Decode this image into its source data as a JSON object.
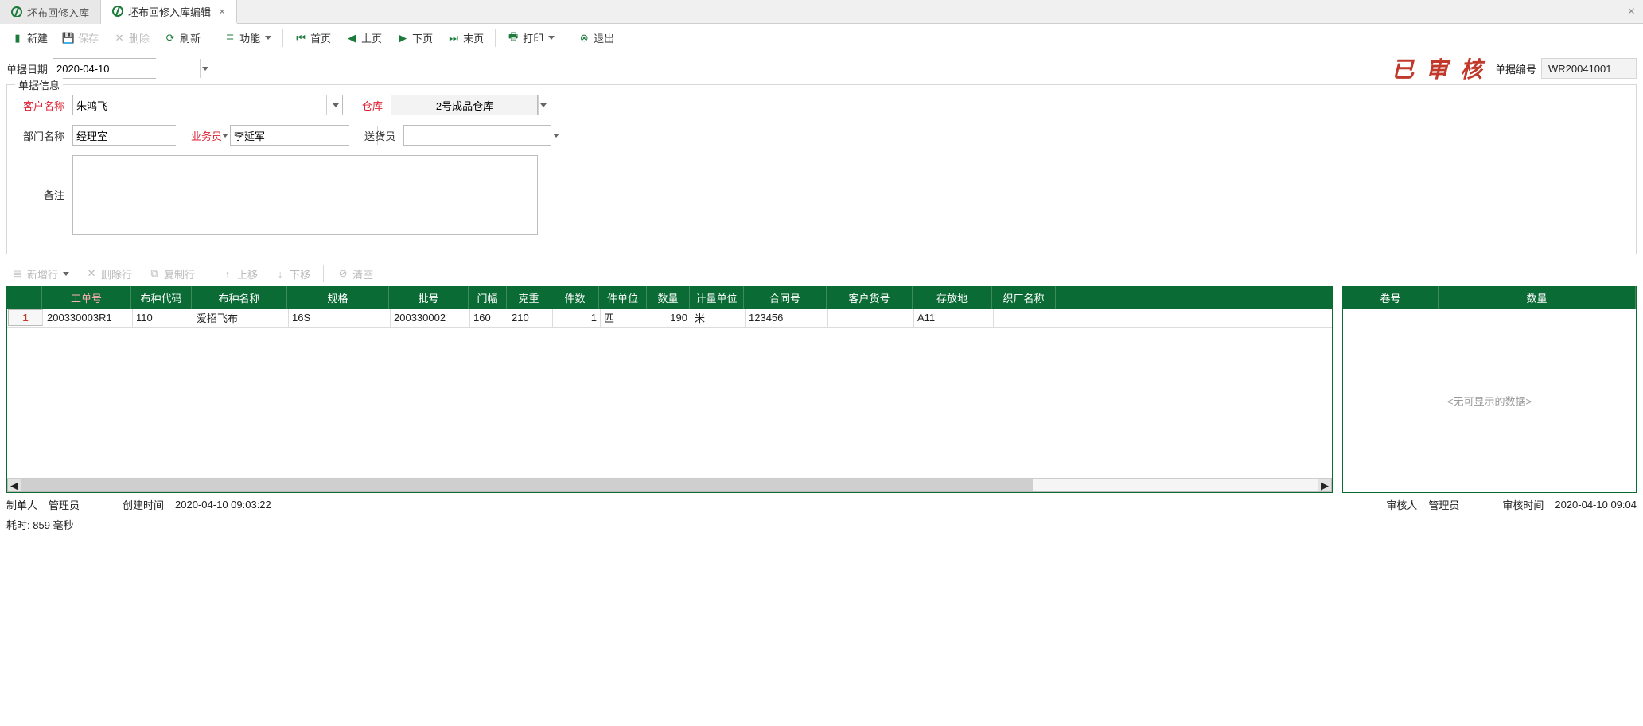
{
  "tabs": [
    {
      "label": "坯布回修入库",
      "active": false,
      "closable": false
    },
    {
      "label": "坯布回修入库编辑",
      "active": true,
      "closable": true
    }
  ],
  "toolbar": {
    "new": "新建",
    "save": "保存",
    "delete": "删除",
    "refresh": "刷新",
    "functions": "功能",
    "first": "首页",
    "prev": "上页",
    "next": "下页",
    "last": "末页",
    "print": "打印",
    "exit": "退出"
  },
  "date_row": {
    "date_label": "单据日期",
    "date_value": "2020-04-10",
    "stamp": "已 审 核",
    "docno_label": "单据编号",
    "docno_value": "WR20041001"
  },
  "form": {
    "legend": "单据信息",
    "customer_label": "客户名称",
    "customer_value": "朱鸿飞",
    "warehouse_label": "仓库",
    "warehouse_value": "2号成品仓库",
    "dept_label": "部门名称",
    "dept_value": "经理室",
    "salesman_label": "业务员",
    "salesman_value": "李延军",
    "courier_label": "送货员",
    "courier_value": "",
    "remarks_label": "备注",
    "remarks_value": ""
  },
  "grid_toolbar": {
    "add_row": "新增行",
    "del_row": "删除行",
    "copy_row": "复制行",
    "move_up": "上移",
    "move_down": "下移",
    "clear": "清空"
  },
  "grid_left": {
    "columns": [
      "工单号",
      "布种代码",
      "布种名称",
      "规格",
      "批号",
      "门幅",
      "克重",
      "件数",
      "件单位",
      "数量",
      "计量单位",
      "合同号",
      "客户货号",
      "存放地",
      "织厂名称"
    ],
    "required_cols": [
      0
    ],
    "rows": [
      {
        "idx": "1",
        "cells": [
          "200330003R1",
          "110",
          "爱招飞布",
          "16S",
          "200330002",
          "160",
          "210",
          "1",
          "匹",
          "190",
          "米",
          "123456",
          "",
          "A11",
          ""
        ]
      }
    ]
  },
  "grid_right": {
    "columns": [
      "卷号",
      "数量"
    ],
    "empty_text": "<无可显示的数据>"
  },
  "footer": {
    "creator_label": "制单人",
    "creator_value": "管理员",
    "create_time_label": "创建时间",
    "create_time_value": "2020-04-10 09:03:22",
    "auditor_label": "审核人",
    "auditor_value": "管理员",
    "audit_time_label": "审核时间",
    "audit_time_value": "2020-04-10 09:04",
    "elapsed_label": "耗时:",
    "elapsed_value": "859 毫秒"
  }
}
